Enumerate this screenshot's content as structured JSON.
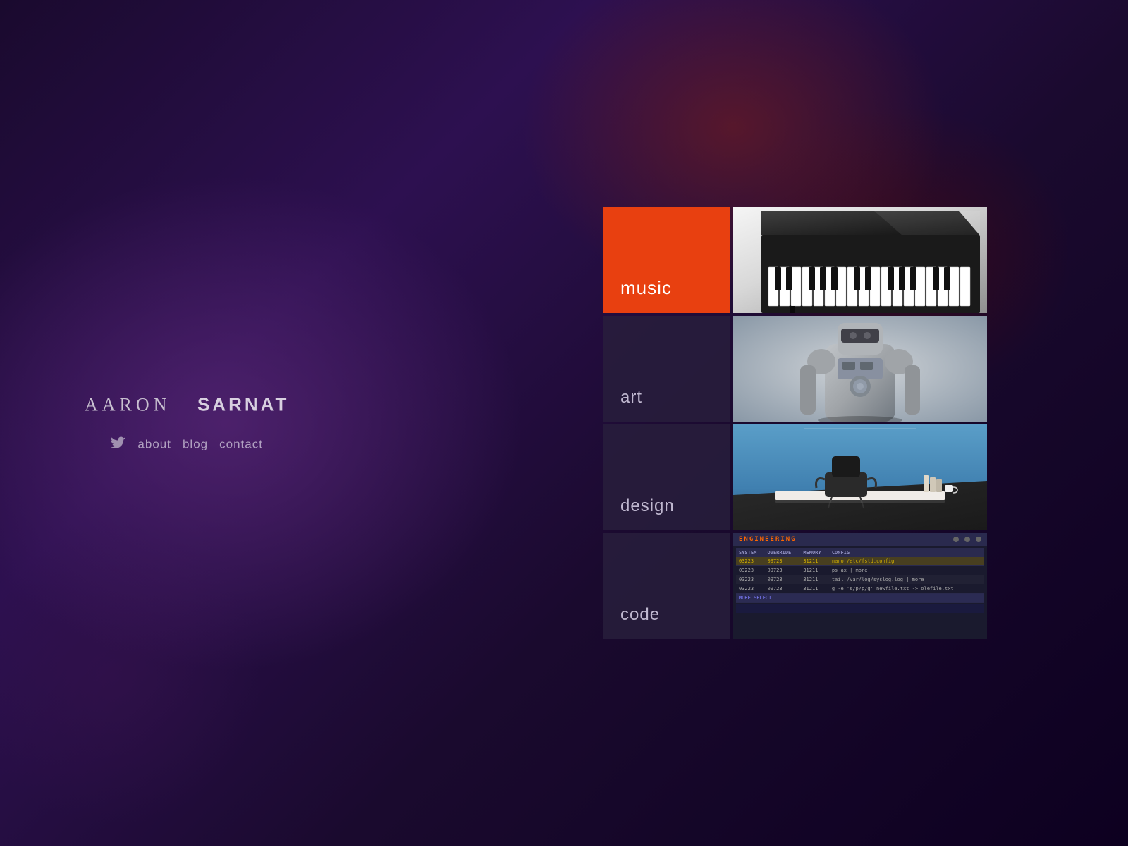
{
  "site": {
    "first_name": "AARON",
    "last_name": "SARNAT"
  },
  "nav": {
    "twitter_label": "twitter",
    "about_label": "about",
    "blog_label": "blog",
    "contact_label": "contact"
  },
  "grid": {
    "music_label": "music",
    "art_label": "art",
    "design_label": "design",
    "code_label": "code"
  },
  "terminal": {
    "title": "ENGINEERING",
    "headers": [
      "SYSTEM",
      "OVERRIDE",
      "MEMORY",
      "CONFIG"
    ],
    "rows": [
      [
        "03223",
        "09723",
        "31211",
        "nano /etc/fstd.config"
      ],
      [
        "03223",
        "09723",
        "31211",
        "ps ax | more"
      ],
      [
        "03223",
        "09723",
        "31211",
        "tail /var/log/syslog.log | more"
      ],
      [
        "03223",
        "09723",
        "31211",
        "g -e 's/p/p/g' newfile.txt -> olefile.txt"
      ]
    ],
    "select_label": "MORE SELECT"
  },
  "colors": {
    "music_active": "#e84010",
    "bg_dark": "#1a0a2e",
    "cell_bg": "rgba(40,30,60,0.85)",
    "text_light": "#c0b8d0"
  }
}
